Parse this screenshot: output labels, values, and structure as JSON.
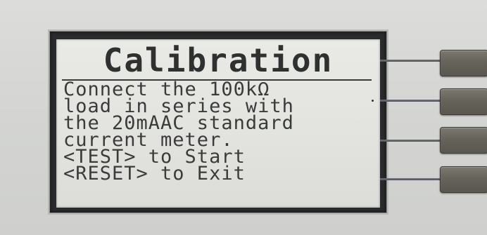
{
  "display": {
    "title": "Calibration",
    "lines": [
      "Connect the 100kΩ",
      "load in series with",
      "the 20mAAC standard",
      "current meter.",
      "<TEST> to Start",
      "<RESET> to Exit"
    ]
  },
  "softkeys": [
    {
      "label": ""
    },
    {
      "label": ""
    },
    {
      "label": ""
    },
    {
      "label": ""
    }
  ],
  "colors": {
    "lcd_background": "#e4e5e1",
    "lcd_text": "#3a3c3b",
    "panel": "#d6d7d5",
    "softkey": "#6a675f"
  }
}
